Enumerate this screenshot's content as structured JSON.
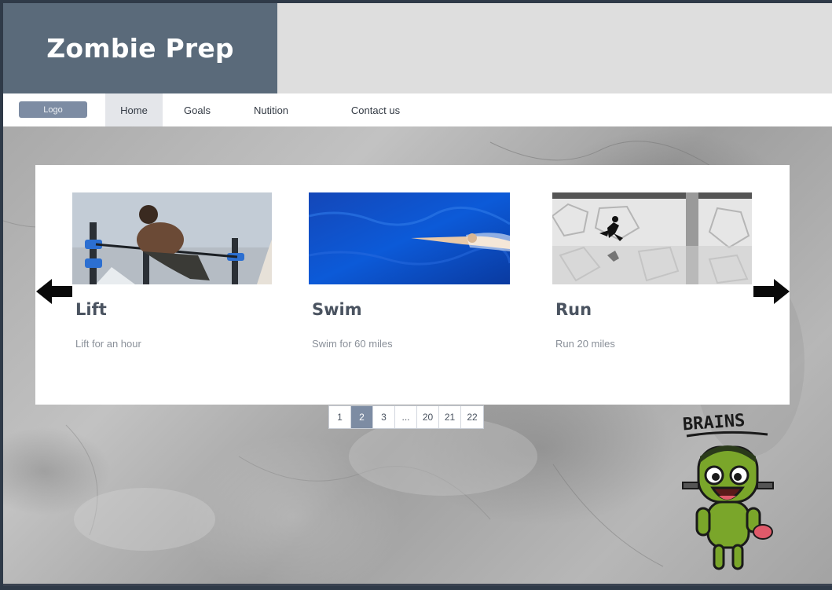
{
  "header": {
    "title": "Zombie Prep"
  },
  "nav": {
    "logo_label": "Logo",
    "items": [
      {
        "label": "Home"
      },
      {
        "label": "Goals"
      },
      {
        "label": "Nutition"
      },
      {
        "label": "Contact us"
      }
    ],
    "active_index": 0
  },
  "carousel": {
    "cards": [
      {
        "title": "Lift",
        "description": "Lift for an hour",
        "image": "man-doing-pullups-photo"
      },
      {
        "title": "Swim",
        "description": "Swim for 60 miles",
        "image": "swimmer-in-blue-water-photo"
      },
      {
        "title": "Run",
        "description": "Run 20 miles",
        "image": "runner-silhouette-photo"
      }
    ],
    "prev_icon": "arrow-left-icon",
    "next_icon": "arrow-right-icon"
  },
  "pagination": {
    "pages": [
      "1",
      "2",
      "3",
      "...",
      "20",
      "21",
      "22"
    ],
    "active_page": "2"
  },
  "mascot": {
    "caption": "BRAINS"
  },
  "colors": {
    "banner": "#5a6a7a",
    "accent": "#7d8ca3",
    "text_dark": "#4a5360",
    "text_muted": "#8a9099"
  }
}
